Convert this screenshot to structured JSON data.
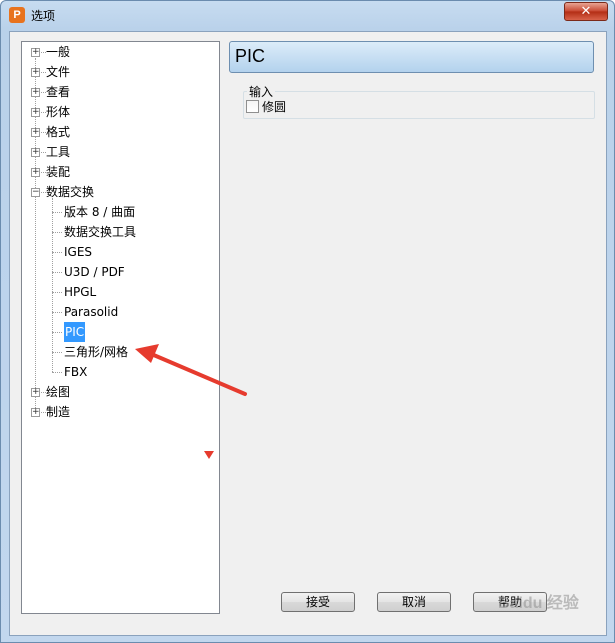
{
  "window": {
    "title": "选项",
    "close_symbol": "✕",
    "app_icon_letter": "P"
  },
  "tree": {
    "items": [
      {
        "label": "一般",
        "expander": "+"
      },
      {
        "label": "文件",
        "expander": "+"
      },
      {
        "label": "查看",
        "expander": "+"
      },
      {
        "label": "形体",
        "expander": "+"
      },
      {
        "label": "格式",
        "expander": "+"
      },
      {
        "label": "工具",
        "expander": "+"
      },
      {
        "label": "装配",
        "expander": "+"
      },
      {
        "label": "数据交换",
        "expander": "−"
      },
      {
        "label": "版本 8 / 曲面"
      },
      {
        "label": "数据交换工具"
      },
      {
        "label": "IGES"
      },
      {
        "label": "U3D / PDF"
      },
      {
        "label": "HPGL"
      },
      {
        "label": "Parasolid"
      },
      {
        "label": "PIC",
        "selected": true
      },
      {
        "label": "三角形/网格"
      },
      {
        "label": "FBX"
      },
      {
        "label": "绘图",
        "expander": "+"
      },
      {
        "label": "制造",
        "expander": "+"
      }
    ]
  },
  "panel": {
    "title": "PIC",
    "group_label": "输入",
    "checkbox_label": "修圆",
    "checkbox_checked": false
  },
  "buttons": {
    "accept": "接受",
    "cancel": "取消",
    "help": "帮助"
  },
  "watermark": "Baidu 经验"
}
